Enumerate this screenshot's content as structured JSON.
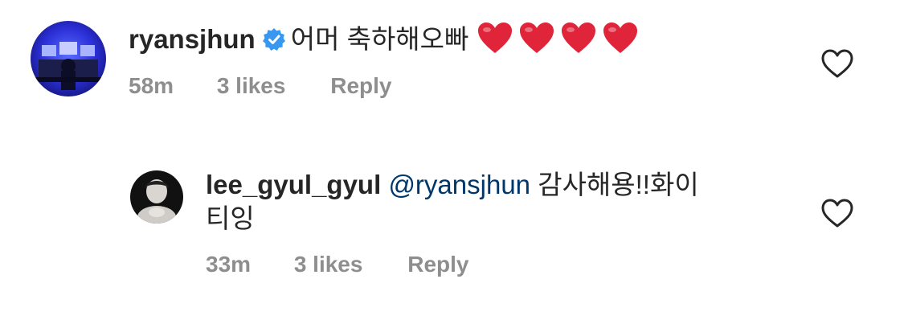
{
  "comments": [
    {
      "username": "ryansjhun",
      "verified": true,
      "text": "어머 축하해오빠",
      "emoji": "❤️❤️❤️❤️",
      "time": "58m",
      "likes": "3 likes",
      "reply": "Reply"
    },
    {
      "username": "lee_gyul_gyul",
      "verified": false,
      "mention": "@ryansjhun",
      "text_line1": "감사해용!!화이",
      "text_line2": "티잉",
      "time": "33m",
      "likes": "3 likes",
      "reply": "Reply"
    }
  ],
  "colors": {
    "text": "#262626",
    "secondary": "#8e8e8e",
    "mention": "#00376b",
    "verified_badge": "#3897f0",
    "heart_emoji": "#e0243a"
  }
}
